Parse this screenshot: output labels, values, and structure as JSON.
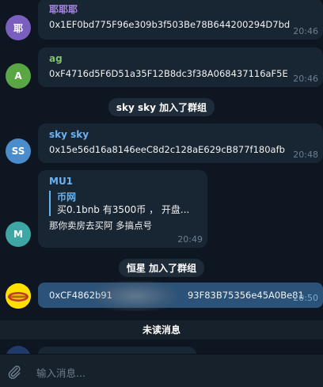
{
  "messages": [
    {
      "avatar_text": "耶",
      "avatar_color": "#7a5fbf",
      "sender": "耶耶耶",
      "sender_color": "#b083f0",
      "text": "0x1EF0bd775F96e309b3f503Be78B644200294D7bd",
      "time": "20:46"
    },
    {
      "avatar_text": "A",
      "avatar_color": "#5aa544",
      "sender": "ag",
      "sender_color": "#7ec26f",
      "text": "0xF4716d5F6D51a35F12B8dc3f38A068437116aF5E",
      "time": "20:46"
    },
    {
      "avatar_text": "SS",
      "avatar_color": "#4a8ccc",
      "sender": "sky sky",
      "sender_color": "#6ab3f3",
      "text": "0x15e56d16a8146eeC8d2c128aE629cB877f180afb",
      "time": "20:48"
    },
    {
      "avatar_text": "M",
      "avatar_color": "#3fa6a6",
      "sender": "MU1",
      "sender_color": "#6ab3f3",
      "quote_name": "币网",
      "quote_text": "买0.1bnb 有3500币 ， 开盘...",
      "text": "那你卖房去买阿 多搞点号",
      "time": "20:49"
    },
    {
      "avatar_text": "",
      "avatar_color": "#ffe000",
      "text_left": "0xCF4862b91",
      "text_right": "93F83B75356e45A0Be81",
      "time": "20:50"
    }
  ],
  "service": {
    "joined1": "sky sky 加入了群组",
    "joined2": "恒星 加入了群组"
  },
  "unread_label": "未读消息",
  "composer": {
    "placeholder": "输入消息..."
  }
}
